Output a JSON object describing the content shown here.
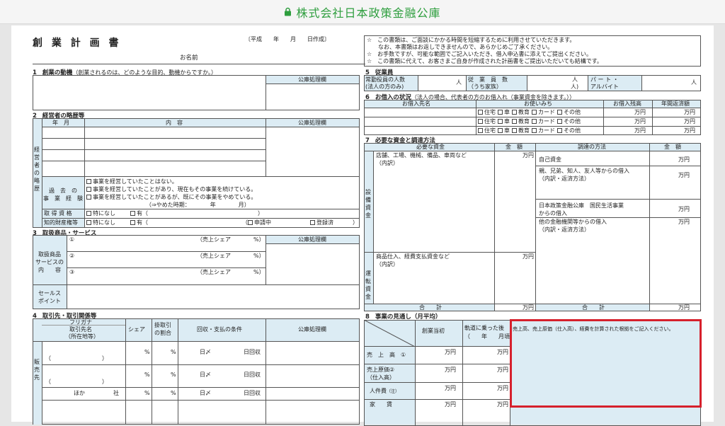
{
  "topbar": {
    "title": "株式会社日本政策金融公庫",
    "lock_icon": "lock-icon",
    "title_color": "#2e9e3e"
  },
  "header": {
    "doc_title": "創 業 計 画 書",
    "date_line": "〔平成　　年　　月　　日作成〕",
    "name_label": "お名前",
    "notes": [
      "☆　この書類は、ご面談にかかる時間を短縮するために利用させていただきます。",
      "　　なお、本書類はお返しできませんので、あらかじめご了承ください。",
      "☆　お手数ですが、可能な範囲でご記入いただき、借入申込書に添えてご提出ください。",
      "☆　この書類に代えて、お客さまご自身が作成された計画書をご提出いただいても結構です。"
    ]
  },
  "common": {
    "office_col": "公庫処理欄",
    "man_yen": "万円",
    "person": "人",
    "person_paren": "人)"
  },
  "s1": {
    "num": "1",
    "title": "創業の動機",
    "sub": "（創業されるのは、どのような目的、動機からですか。）"
  },
  "s2": {
    "num": "2",
    "title": "経営者の略歴等",
    "side": "経営者の略歴",
    "col_ym": "年　月",
    "col_content": "内　容",
    "past_label": "過　去　の\n事　業　経　験",
    "past_options": [
      "事業を経営していたことはない。",
      "事業を経営していたことがあり、現在もその事業を続けている。",
      "事業を経営していたことがあるが、既にその事業をやめている。"
    ],
    "past_closed": "（⇒やめた時期：　　　　年　　　　月）",
    "license_label": "取 得 資 格",
    "ip_label": "知的財産権等",
    "none": "特になし",
    "yes": "有（",
    "close_paren": "）",
    "pending": "申請中",
    "registered": "登録済"
  },
  "s3": {
    "num": "3",
    "title": "取扱商品・サービス",
    "side": "取扱商品\nサービスの\n内　　容",
    "items": [
      "①",
      "②",
      "③"
    ],
    "share": "（売上シェア　　　　%）",
    "sales_point": "セールス\nポイント"
  },
  "s4": {
    "num": "4",
    "title": "取引先・取引関係等",
    "col_furigana": "フリガナ",
    "col_name": "取引先名",
    "col_addr": "（所在地等）",
    "col_share": "シェア",
    "col_credit": "掛取引\nの割合",
    "col_terms": "回収・支払の条件",
    "side": "販売先",
    "pct": "%",
    "day_close": "日〆",
    "day_collect": "日回収",
    "paren": "（　　　　　　　　　）",
    "other": "ほか　　　　　社"
  },
  "s5": {
    "num": "5",
    "title": "従業員",
    "regular": "常勤役員の人数\n(法人の方のみ)",
    "employees": "従　業　員　数\n（うち家族）",
    "part": "パ ー ト ・\nアルバイト"
  },
  "s6": {
    "num": "6",
    "title": "お借入の状況",
    "sub": "（法人の場合、代表者の方のお借入れ（事業資金を除きます。））",
    "col_lender": "お借入先名",
    "col_use": "お使いみち",
    "col_balance": "お借入残高",
    "col_repay": "年間返済額",
    "use_options": [
      "住宅",
      "車",
      "教育",
      "カード",
      "その他"
    ]
  },
  "s7": {
    "num": "7",
    "title": "必要な資金と調達方法",
    "col_need": "必要な資金",
    "col_amount": "金　額",
    "col_method": "調達の方法",
    "equip_side": "設備資金",
    "op_side": "運転資金",
    "equip_item": "店舗、工場、機械、備品、車両など",
    "detail": "（内訳）",
    "op_item": "商品仕入、経費支払資金など",
    "own": "自己資金",
    "family": "親、兄弟、知人、友人等からの借入",
    "family_detail": "（内訳・返済方法）",
    "jfc": "日本政策金融公庫　国民生活事業\nからの借入",
    "other_bank": "他の金融機関等からの借入",
    "total": "合　　計"
  },
  "s8": {
    "num": "8",
    "title": "事業の見通し（月平均）",
    "col_start": "創業当初",
    "col_stable": "軌道に乗った後",
    "col_stable_sub": "（　　年　　月頃）",
    "note": "売上高、売上原価（仕入高）、経費を計算された根拠をご記入ください。",
    "sales": "売　上　高　①",
    "cost": "売上原価②\n（仕入高）",
    "labor": "人件費",
    "labor_note": "（注）",
    "rent": "家　　賃",
    "highlight_color": "#d6202c",
    "fill_color": "#dcecf4"
  }
}
